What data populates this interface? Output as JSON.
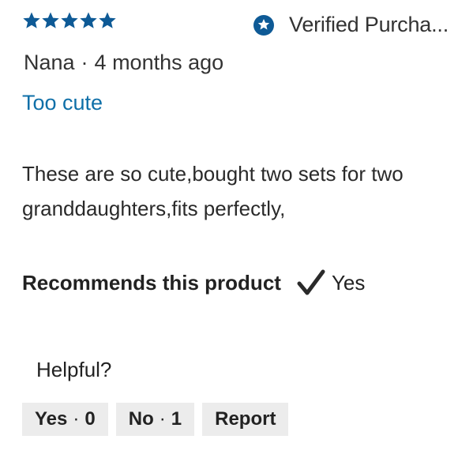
{
  "review": {
    "rating": 5,
    "rating_max": 5,
    "verified_label": "Verified Purcha...",
    "author": "Nana",
    "separator": "·",
    "time_ago": "4 months ago",
    "title": "Too cute",
    "body": "These are so cute,bought two sets for two granddaughters,fits perfectly,",
    "recommends_label": "Recommends this product",
    "recommends_value": "Yes"
  },
  "helpful": {
    "label": "Helpful?",
    "yes_label": "Yes",
    "yes_count": "0",
    "no_label": "No",
    "no_count": "1",
    "report_label": "Report"
  },
  "colors": {
    "star": "#0e5a96",
    "link": "#0e6fa8",
    "verified_icon": "#0e5a96",
    "button_bg": "#ececec",
    "text": "#2a2a2a"
  },
  "icons": {
    "star": "star-icon",
    "verified": "verified-badge-icon",
    "check": "checkmark-icon"
  }
}
